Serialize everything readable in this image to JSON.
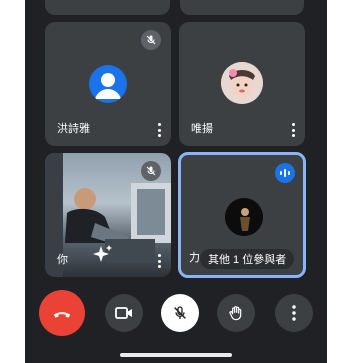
{
  "participants": [
    {
      "name": "洪詩雅",
      "muted": true
    },
    {
      "name": "唯揚",
      "muted": false
    },
    {
      "name": "你",
      "muted": true
    },
    {
      "name_prefix": "力",
      "others_label": "其他 1 位參與者",
      "speaking": true
    }
  ],
  "controls": {
    "end_call": "end-call",
    "camera": "camera",
    "mic": "mic-off",
    "raise_hand": "raise-hand",
    "more": "more-options"
  },
  "colors": {
    "background": "#202124",
    "tile": "#3c4043",
    "accent": "#8ab4f8",
    "end_call": "#ea4335",
    "speaking_badge": "#1a73e8"
  }
}
